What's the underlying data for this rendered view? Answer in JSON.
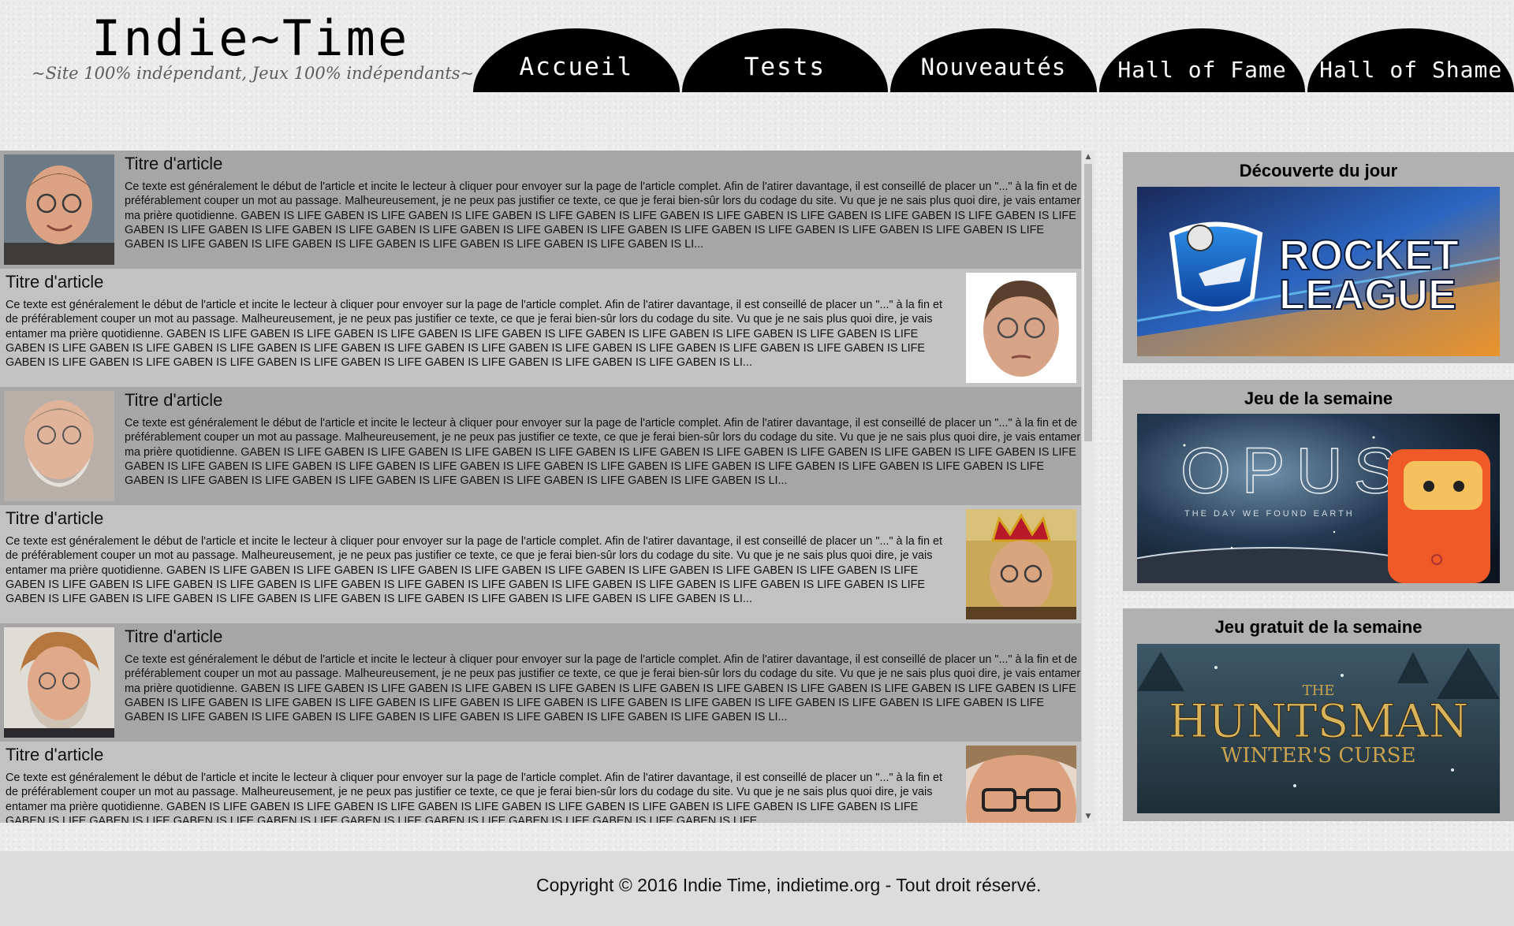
{
  "header": {
    "site_title": "Indie~Time",
    "slogan": "~Site 100% indépendant, Jeux 100% indépendants~"
  },
  "nav": {
    "items": [
      {
        "label": "Accueil"
      },
      {
        "label": "Tests"
      },
      {
        "label": "Nouveautés"
      },
      {
        "label": "Hall of Fame"
      },
      {
        "label": "Hall of Shame"
      }
    ]
  },
  "articles": [
    {
      "title": "Titre d'article",
      "excerpt": "Ce texte est généralement le début de l'article et incite le lecteur à cliquer pour envoyer sur la page de l'article complet. Afin de l'atirer davantage, il est conseillé de placer un \"...\" à la fin et de préférablement couper un mot au passage. Malheureusement, je ne peux pas justifier ce texte, ce que je ferai bien-sûr lors du codage du site. Vu que je ne sais plus quoi dire, je vais entamer ma prière quotidienne. GABEN IS LIFE GABEN IS LIFE GABEN IS LIFE GABEN IS LIFE GABEN IS LIFE GABEN IS LIFE GABEN IS LIFE GABEN IS LIFE GABEN IS LIFE GABEN IS LIFE GABEN IS LIFE GABEN IS LIFE GABEN IS LIFE GABEN IS LIFE GABEN IS LIFE GABEN IS LIFE GABEN IS LIFE GABEN IS LIFE GABEN IS LIFE GABEN IS LIFE GABEN IS LIFE GABEN IS LIFE GABEN IS LIFE GABEN IS LIFE GABEN IS LIFE GABEN IS LIFE GABEN IS LIFE GABEN IS LI...",
      "image": "portrait-smiling-glasses"
    },
    {
      "title": "Titre d'article",
      "excerpt": "Ce texte est généralement le début de l'article et incite le lecteur à cliquer pour envoyer sur la page de l'article complet. Afin de l'atirer davantage, il est conseillé de placer un \"...\" à la fin et de préférablement couper un mot au passage. Malheureusement, je ne peux pas justifier ce texte, ce que je ferai bien-sûr lors du codage du site. Vu que je ne sais plus quoi dire, je vais entamer ma prière quotidienne. GABEN IS LIFE GABEN IS LIFE GABEN IS LIFE GABEN IS LIFE GABEN IS LIFE GABEN IS LIFE GABEN IS LIFE GABEN IS LIFE GABEN IS LIFE GABEN IS LIFE GABEN IS LIFE GABEN IS LIFE GABEN IS LIFE GABEN IS LIFE GABEN IS LIFE GABEN IS LIFE GABEN IS LIFE GABEN IS LIFE GABEN IS LIFE GABEN IS LIFE GABEN IS LIFE GABEN IS LIFE GABEN IS LIFE GABEN IS LIFE GABEN IS LIFE GABEN IS LIFE GABEN IS LIFE GABEN IS LIFE GABEN IS LI...",
      "image": "portrait-cutout-face"
    },
    {
      "title": "Titre d'article",
      "excerpt": "Ce texte est généralement le début de l'article et incite le lecteur à cliquer pour envoyer sur la page de l'article complet. Afin de l'atirer davantage, il est conseillé de placer un \"...\" à la fin et de préférablement couper un mot au passage. Malheureusement, je ne peux pas justifier ce texte, ce que je ferai bien-sûr lors du codage du site. Vu que je ne sais plus quoi dire, je vais entamer ma prière quotidienne. GABEN IS LIFE GABEN IS LIFE GABEN IS LIFE GABEN IS LIFE GABEN IS LIFE GABEN IS LIFE GABEN IS LIFE GABEN IS LIFE GABEN IS LIFE GABEN IS LIFE GABEN IS LIFE GABEN IS LIFE GABEN IS LIFE GABEN IS LIFE GABEN IS LIFE GABEN IS LIFE GABEN IS LIFE GABEN IS LIFE GABEN IS LIFE GABEN IS LIFE GABEN IS LIFE GABEN IS LIFE GABEN IS LIFE GABEN IS LIFE GABEN IS LIFE GABEN IS LIFE GABEN IS LIFE GABEN IS LIFE GABEN IS LI...",
      "image": "portrait-bearded-glasses"
    },
    {
      "title": "Titre d'article",
      "excerpt": "Ce texte est généralement le début de l'article et incite le lecteur à cliquer pour envoyer sur la page de l'article complet. Afin de l'atirer davantage, il est conseillé de placer un \"...\" à la fin et de préférablement couper un mot au passage. Malheureusement, je ne peux pas justifier ce texte, ce que je ferai bien-sûr lors du codage du site. Vu que je ne sais plus quoi dire, je vais entamer ma prière quotidienne. GABEN IS LIFE GABEN IS LIFE GABEN IS LIFE GABEN IS LIFE GABEN IS LIFE GABEN IS LIFE GABEN IS LIFE GABEN IS LIFE GABEN IS LIFE GABEN IS LIFE GABEN IS LIFE GABEN IS LIFE GABEN IS LIFE GABEN IS LIFE GABEN IS LIFE GABEN IS LIFE GABEN IS LIFE GABEN IS LIFE GABEN IS LIFE GABEN IS LIFE GABEN IS LIFE GABEN IS LIFE GABEN IS LIFE GABEN IS LIFE GABEN IS LIFE GABEN IS LIFE GABEN IS LIFE GABEN IS LIFE GABEN IS LI...",
      "image": "portrait-crowned"
    },
    {
      "title": "Titre d'article",
      "excerpt": "Ce texte est généralement le début de l'article et incite le lecteur à cliquer pour envoyer sur la page de l'article complet. Afin de l'atirer davantage, il est conseillé de placer un \"...\" à la fin et de préférablement couper un mot au passage. Malheureusement, je ne peux pas justifier ce texte, ce que je ferai bien-sûr lors du codage du site. Vu que je ne sais plus quoi dire, je vais entamer ma prière quotidienne. GABEN IS LIFE GABEN IS LIFE GABEN IS LIFE GABEN IS LIFE GABEN IS LIFE GABEN IS LIFE GABEN IS LIFE GABEN IS LIFE GABEN IS LIFE GABEN IS LIFE GABEN IS LIFE GABEN IS LIFE GABEN IS LIFE GABEN IS LIFE GABEN IS LIFE GABEN IS LIFE GABEN IS LIFE GABEN IS LIFE GABEN IS LIFE GABEN IS LIFE GABEN IS LIFE GABEN IS LIFE GABEN IS LIFE GABEN IS LIFE GABEN IS LIFE GABEN IS LIFE GABEN IS LIFE GABEN IS LIFE GABEN IS LI...",
      "image": "portrait-event-photo"
    },
    {
      "title": "Titre d'article",
      "excerpt": "Ce texte est généralement le début de l'article et incite le lecteur à cliquer pour envoyer sur la page de l'article complet. Afin de l'atirer davantage, il est conseillé de placer un \"...\" à la fin et de préférablement couper un mot au passage. Malheureusement, je ne peux pas justifier ce texte, ce que je ferai bien-sûr lors du codage du site. Vu que je ne sais plus quoi dire, je vais entamer ma prière quotidienne. GABEN IS LIFE GABEN IS LIFE GABEN IS LIFE GABEN IS LIFE GABEN IS LIFE GABEN IS LIFE GABEN IS LIFE GABEN IS LIFE GABEN IS LIFE GABEN IS LIFE GABEN IS LIFE GABEN IS LIFE GABEN IS LIFE GABEN IS LIFE GABEN IS LIFE GABEN IS LIFE GABEN IS LIFE GABEN IS LIFE",
      "image": "portrait-closeup-glasses"
    }
  ],
  "sidebar": {
    "cards": [
      {
        "title": "Découverte du jour",
        "game_logo_line1": "ROCKET",
        "game_logo_line2": "LEAGUE"
      },
      {
        "title": "Jeu de la semaine",
        "game_logo_line1": "OPUS",
        "game_logo_line2": "THE DAY WE FOUND EARTH"
      },
      {
        "title": "Jeu gratuit de la semaine",
        "game_logo_line1": "THE",
        "game_logo_line2": "HUNTSMAN",
        "game_logo_line3": "WINTER'S CURSE"
      }
    ]
  },
  "footer": {
    "copyright": "Copyright © 2016 Indie Time, indietime.org - Tout droit réservé."
  },
  "colors": {
    "nav_background": "#000000",
    "article_dark": "#a6a6a6",
    "article_light": "#c2c2c2",
    "sidebar_card": "#b1b1b1"
  }
}
